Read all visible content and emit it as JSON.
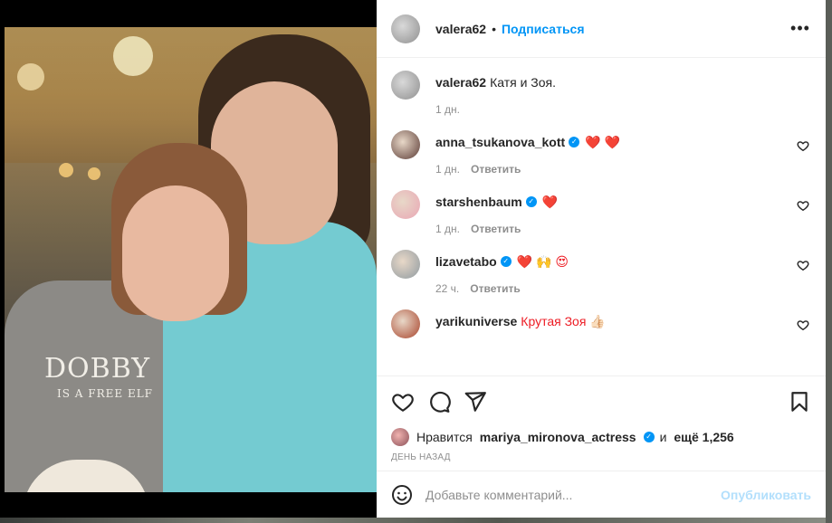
{
  "post": {
    "author": "valera62",
    "follow_label": "Подписаться",
    "dot": "•",
    "more_label": "•••",
    "caption": {
      "username": "valera62",
      "text": "Катя и Зоя.",
      "time": "1 дн."
    },
    "photo": {
      "shirt_print": "DOBBY",
      "shirt_print_small": "IS A FREE ELF"
    }
  },
  "comments": [
    {
      "username": "anna_tsukanova_kott",
      "verified": true,
      "text": "❤️ ❤️",
      "time": "1 дн.",
      "reply_label": "Ответить",
      "avatar_color": "#5a3a34"
    },
    {
      "username": "starshenbaum",
      "verified": true,
      "text": "❤️",
      "time": "1 дн.",
      "reply_label": "Ответить",
      "avatar_color": "#e9a6b4"
    },
    {
      "username": "lizavetabo",
      "verified": true,
      "text": "❤️ 🙌 😍",
      "time": "22 ч.",
      "reply_label": "Ответить",
      "avatar_color": "#8f9aa0"
    },
    {
      "username": "yarikuniverse",
      "verified": false,
      "text": "Крутая Зоя 👍🏻",
      "time": "",
      "reply_label": "",
      "avatar_color": "#a8432b"
    }
  ],
  "verified_mark": "✓",
  "likes": {
    "prefix": "Нравится",
    "liker": "mariya_mironova_actress",
    "and": "и",
    "more": "ещё 1,256"
  },
  "date_label": "ДЕНЬ НАЗАД",
  "add_comment": {
    "placeholder": "Добавьте комментарий...",
    "publish_label": "Опубликовать"
  },
  "colors": {
    "accent": "#0095f6",
    "publish_disabled": "#b2dffc",
    "meta": "#8e8e8e"
  },
  "icons": {
    "like": "heart-icon",
    "comment": "comment-icon",
    "share": "paper-plane-icon",
    "save": "bookmark-icon",
    "emoji": "smiley-icon",
    "more": "more-icon"
  }
}
